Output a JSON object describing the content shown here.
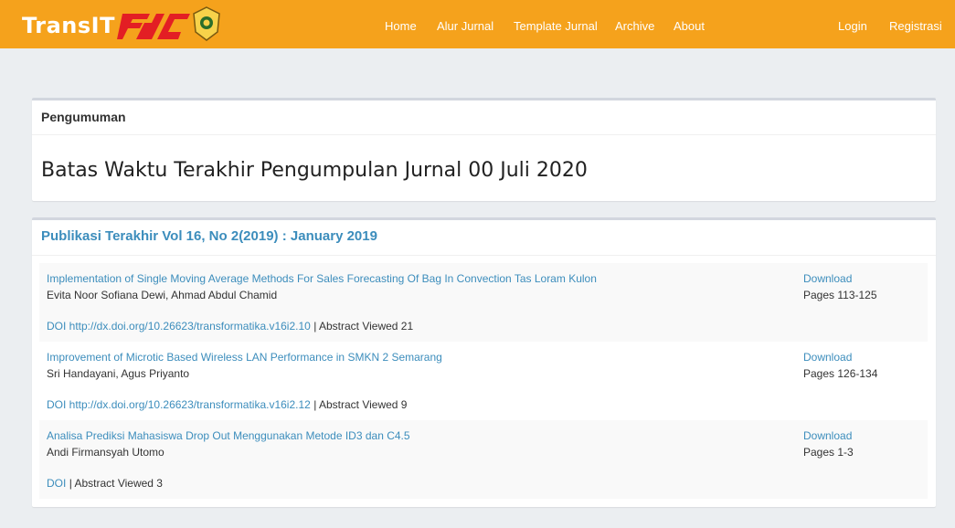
{
  "navbar": {
    "brand": "TransIT",
    "links": [
      "Home",
      "Alur Jurnal",
      "Template Jurnal",
      "Archive",
      "About"
    ],
    "right_links": [
      "Login",
      "Registrasi"
    ],
    "color": "#f5a21c"
  },
  "announcement": {
    "header": "Pengumuman",
    "text": "Batas Waktu Terakhir Pengumpulan Jurnal 00 Juli 2020"
  },
  "publications": {
    "header": "Publikasi Terakhir Vol 16, No 2(2019) : January 2019",
    "articles": [
      {
        "title": "Implementation of Single Moving Average Methods For Sales Forecasting Of Bag In Convection Tas Loram Kulon",
        "authors": "Evita Noor Sofiana Dewi, Ahmad Abdul Chamid",
        "doi": "DOI http://dx.doi.org/10.26623/transformatika.v16i2.10",
        "abstract": "| Abstract Viewed 21",
        "download": "Download",
        "pages": "Pages 113-125"
      },
      {
        "title": "Improvement of Microtic Based Wireless LAN Performance in SMKN 2 Semarang",
        "authors": "Sri Handayani, Agus Priyanto",
        "doi": "DOI http://dx.doi.org/10.26623/transformatika.v16i2.12",
        "abstract": "| Abstract Viewed 9",
        "download": "Download",
        "pages": "Pages 126-134"
      },
      {
        "title": "Analisa Prediksi Mahasiswa Drop Out Menggunakan Metode ID3 dan C4.5",
        "authors": "Andi Firmansyah Utomo",
        "doi": "DOI",
        "abstract": "| Abstract Viewed 3",
        "download": "Download",
        "pages": "Pages 1-3"
      }
    ]
  }
}
